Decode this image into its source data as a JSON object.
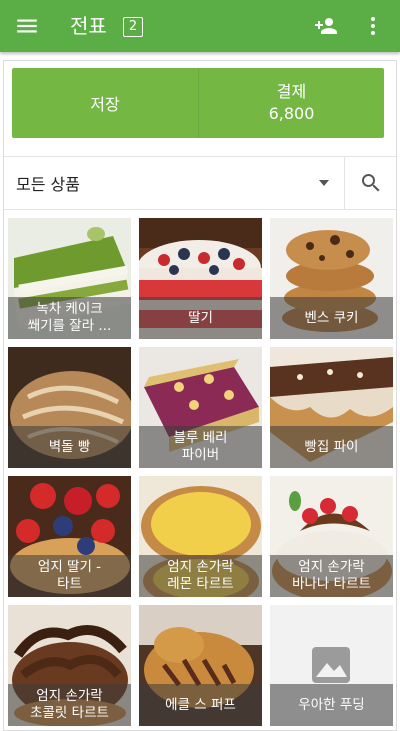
{
  "appbar": {
    "title": "전표",
    "badge": "2",
    "icons": [
      "menu-icon",
      "add-user-icon",
      "more-vert-icon"
    ],
    "color": "#5aae45"
  },
  "actions": {
    "save_label": "저장",
    "pay_label": "결제",
    "pay_amount": "6,800",
    "color": "#75b743"
  },
  "filter": {
    "selected": "모든 상품",
    "icons": [
      "dropdown-caret-icon",
      "search-icon"
    ]
  },
  "products": [
    {
      "name": "녹차 케이크\n쐐기를 잘라 ...",
      "image": "green-tea-cake"
    },
    {
      "name": "딸기",
      "image": "strawberry-cake"
    },
    {
      "name": "벤스 쿠키",
      "image": "cookies"
    },
    {
      "name": "벽돌 빵",
      "image": "bread"
    },
    {
      "name": "블루 베리\n파이버",
      "image": "blueberry-bar"
    },
    {
      "name": "빵집 파이",
      "image": "chocolate-pie"
    },
    {
      "name": "엄지 딸기 -\n타트",
      "image": "strawberry-tart"
    },
    {
      "name": "엄지 손가락\n레몬 타르트",
      "image": "lemon-tart"
    },
    {
      "name": "엄지 손가락\n바나나 타르트",
      "image": "banana-tart"
    },
    {
      "name": "엄지 손가락\n초콜릿 타르트",
      "image": "chocolate-tart"
    },
    {
      "name": "에클 스 퍼프",
      "image": "puff-pastry"
    },
    {
      "name": "우아한 푸딩",
      "image": "placeholder-image-icon"
    }
  ]
}
